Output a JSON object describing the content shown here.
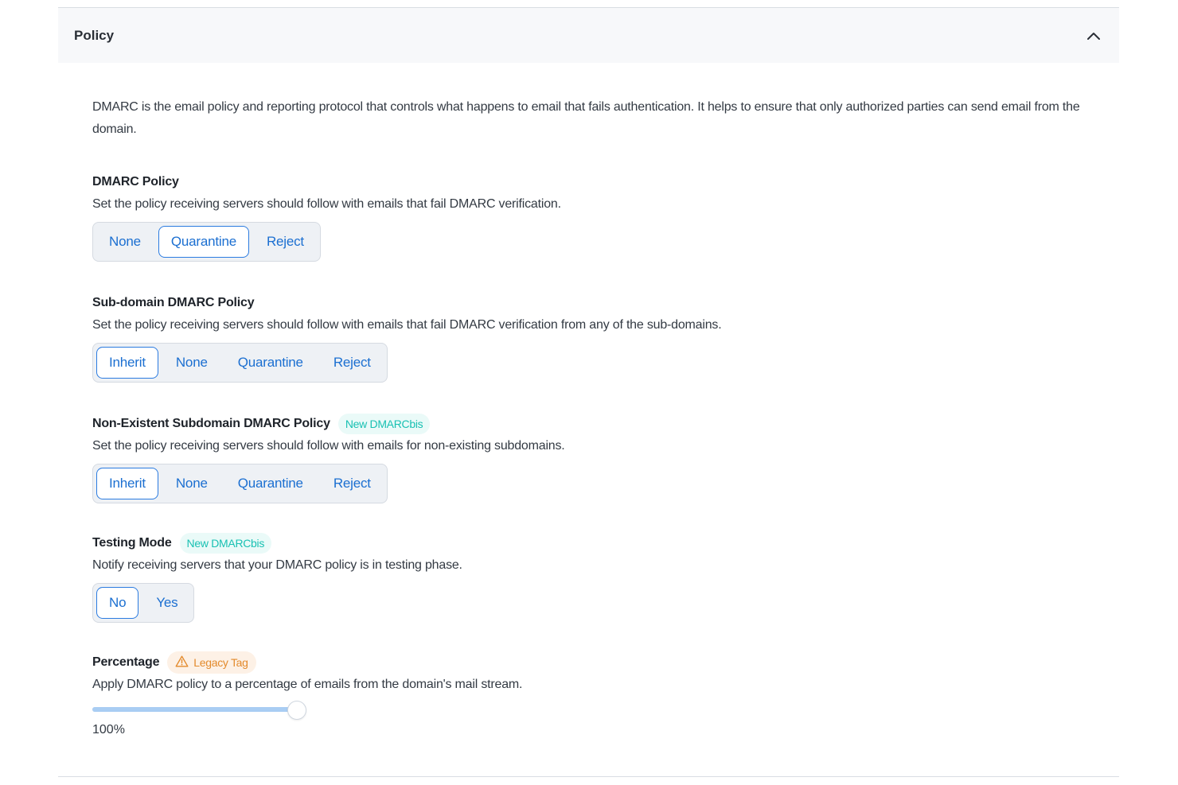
{
  "panel": {
    "title": "Policy",
    "collapse_icon": "chevron-up-icon"
  },
  "intro": "DMARC is the email policy and reporting protocol that controls what happens to email that fails authentication. It helps to ensure that only authorized parties can send email from the domain.",
  "sections": {
    "dmarc_policy": {
      "title": "DMARC Policy",
      "description": "Set the policy receiving servers should follow with emails that fail DMARC verification.",
      "options": [
        "None",
        "Quarantine",
        "Reject"
      ],
      "selected": "Quarantine"
    },
    "subdomain_policy": {
      "title": "Sub-domain DMARC Policy",
      "description": "Set the policy receiving servers should follow with emails that fail DMARC verification from any of the sub-domains.",
      "options": [
        "Inherit",
        "None",
        "Quarantine",
        "Reject"
      ],
      "selected": "Inherit"
    },
    "nonexistent_policy": {
      "title": "Non-Existent Subdomain DMARC Policy",
      "badge": "New DMARCbis",
      "description": "Set the policy receiving servers should follow with emails for non-existing subdomains.",
      "options": [
        "Inherit",
        "None",
        "Quarantine",
        "Reject"
      ],
      "selected": "Inherit"
    },
    "testing_mode": {
      "title": "Testing Mode",
      "badge": "New DMARCbis",
      "description": "Notify receiving servers that your DMARC policy is in testing phase.",
      "options": [
        "No",
        "Yes"
      ],
      "selected": "No"
    },
    "percentage": {
      "title": "Percentage",
      "badge": "Legacy Tag",
      "badge_icon": "warning-icon",
      "description": "Apply DMARC policy to a percentage of emails from the domain's mail stream.",
      "value": 100,
      "value_label": "100%"
    }
  },
  "colors": {
    "accent": "#1b6fd1",
    "new_badge": "#19c1b3",
    "legacy_badge": "#e38a2c"
  }
}
